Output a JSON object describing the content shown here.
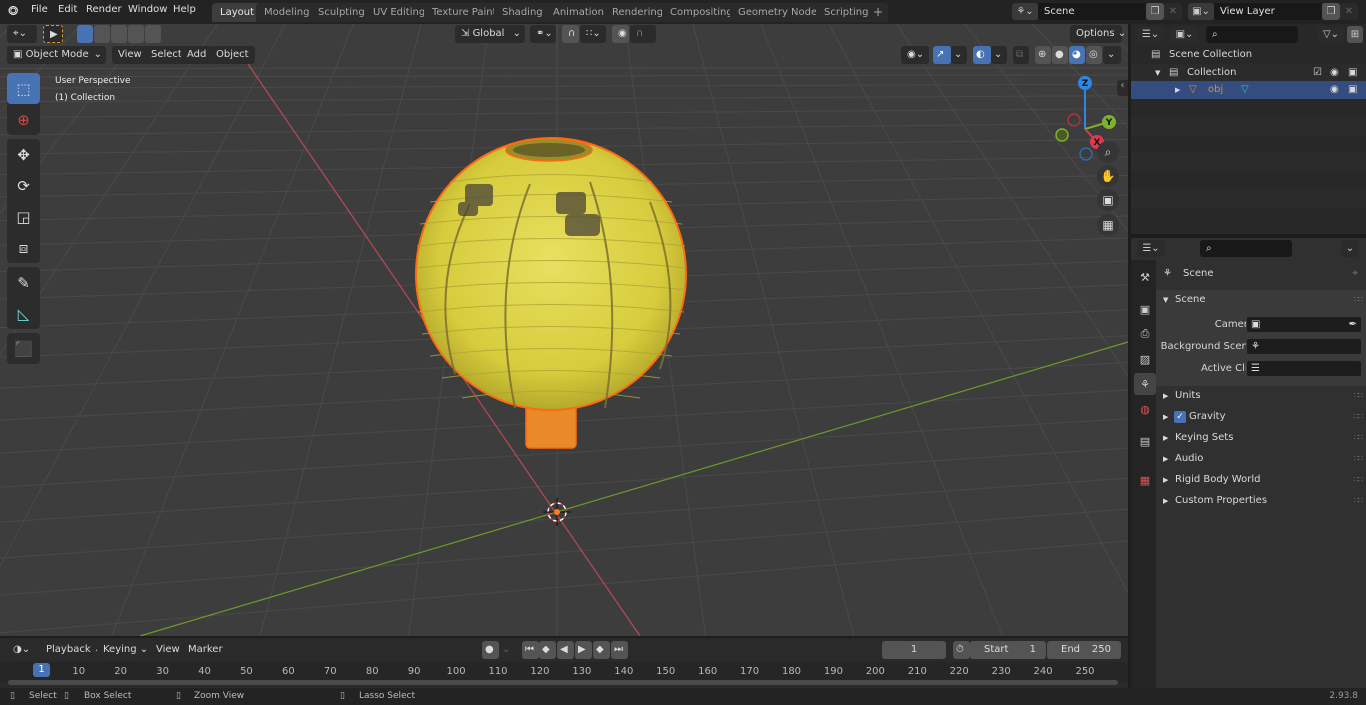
{
  "topbar": {
    "logo_icon": "blender-logo-icon",
    "menus": [
      "File",
      "Edit",
      "Render",
      "Window",
      "Help"
    ],
    "workspaces": [
      "Layout",
      "Modeling",
      "Sculpting",
      "UV Editing",
      "Texture Paint",
      "Shading",
      "Animation",
      "Rendering",
      "Compositing",
      "Geometry Nodes",
      "Scripting"
    ],
    "active_workspace": "Layout",
    "add_workspace": "+",
    "scene_name": "Scene",
    "view_layer_name": "View Layer"
  },
  "viewport": {
    "mode": "Object Mode",
    "menus": [
      "View",
      "Select",
      "Add",
      "Object"
    ],
    "transform_orientation": "Global",
    "options_label": "Options",
    "overlay_title": "User Perspective",
    "overlay_collection": "(1) Collection",
    "gizmo_axes": {
      "x": "X",
      "y": "Y",
      "z": "Z"
    },
    "colors": {
      "x_axis": "#e0384f",
      "y_axis": "#7fb22c",
      "z_axis": "#2e86e6",
      "selection": "#ff7a1a",
      "lantern": "#e6dc50",
      "grid_bg": "#3d3d3d"
    },
    "tools": [
      "select-box",
      "cursor",
      "move",
      "rotate",
      "scale",
      "transform",
      "annotate",
      "measure",
      "add-cube"
    ],
    "active_tool": "select-box"
  },
  "outliner": {
    "root": "Scene Collection",
    "collection": "Collection",
    "object": "obj",
    "search_placeholder": ""
  },
  "properties": {
    "context_title": "Scene",
    "section_title": "Scene",
    "fields": [
      {
        "label": "Camera",
        "value": ""
      },
      {
        "label": "Background Scene",
        "value": ""
      },
      {
        "label": "Active Clip",
        "value": ""
      }
    ],
    "panels": [
      {
        "label": "Units",
        "checkbox": false
      },
      {
        "label": "Gravity",
        "checkbox": true,
        "checked": true
      },
      {
        "label": "Keying Sets",
        "checkbox": false
      },
      {
        "label": "Audio",
        "checkbox": false
      },
      {
        "label": "Rigid Body World",
        "checkbox": false
      },
      {
        "label": "Custom Properties",
        "checkbox": false
      }
    ],
    "tabs": [
      "tool",
      "render",
      "output",
      "view-layer",
      "scene",
      "world",
      "collection",
      "texture"
    ],
    "active_tab": "scene"
  },
  "timeline": {
    "menus": [
      "Playback",
      "Keying",
      "View",
      "Marker"
    ],
    "current_frame": "1",
    "start_label": "Start",
    "start_value": "1",
    "end_label": "End",
    "end_value": "250",
    "playhead": "1",
    "ticks": [
      "10",
      "20",
      "30",
      "40",
      "50",
      "60",
      "70",
      "80",
      "90",
      "100",
      "110",
      "120",
      "130",
      "140",
      "150",
      "160",
      "170",
      "180",
      "190",
      "200",
      "210",
      "220",
      "230",
      "240",
      "250"
    ]
  },
  "statusbar": {
    "select": "Select",
    "box_select": "Box Select",
    "zoom_view": "Zoom View",
    "lasso_select": "Lasso Select",
    "version": "2.93.8"
  }
}
